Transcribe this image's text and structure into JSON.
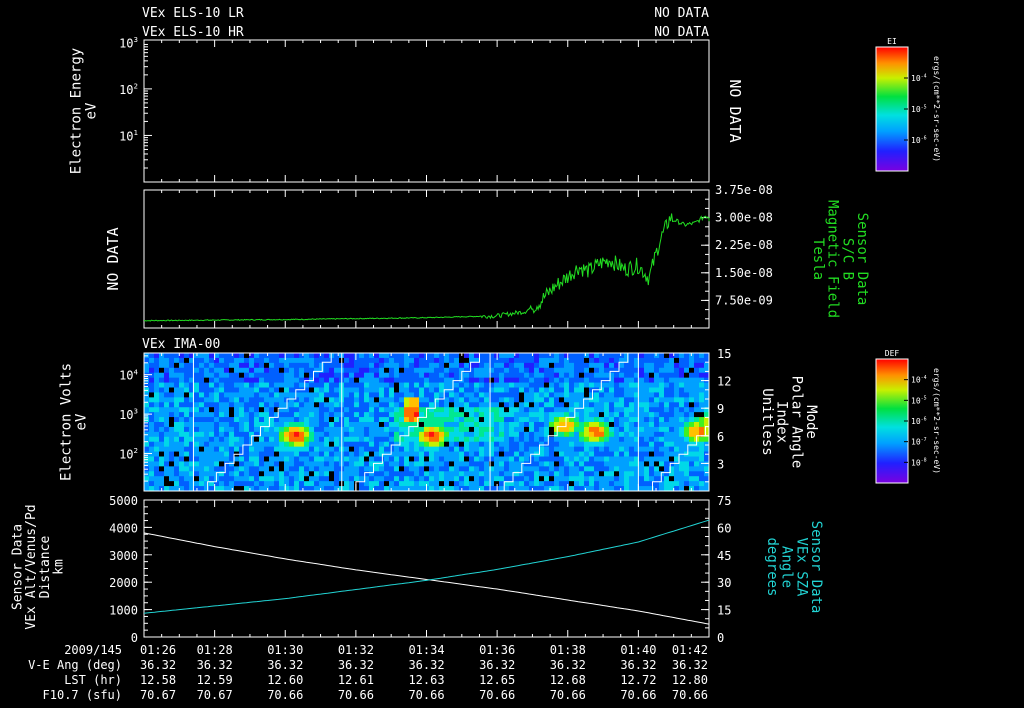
{
  "header": {
    "lr_label": "VEx ELS-10 LR",
    "hr_label": "VEx ELS-10 HR",
    "lr_status": "NO DATA",
    "hr_status": "NO DATA"
  },
  "colors": {
    "background": "#000000",
    "axes": "#ffffff",
    "magnetic_field": "#22dd22",
    "sza": "#22d4d4"
  },
  "chart_data": [
    {
      "type": "heatmap",
      "id": "electron-energy-panel",
      "ylabel": [
        "Electron Energy",
        "eV"
      ],
      "yscale": "log",
      "yticks": [
        {
          "base": "10",
          "exp": "1"
        },
        {
          "base": "10",
          "exp": "2"
        },
        {
          "base": "10",
          "exp": "3"
        }
      ],
      "status": "NO DATA",
      "colorbar": {
        "title": "EI",
        "units": "ergs/(cm**2-sr-sec-eV)",
        "ticks": [
          {
            "base": "10",
            "exp": "-4"
          },
          {
            "base": "10",
            "exp": "-5"
          },
          {
            "base": "10",
            "exp": "-6"
          }
        ]
      }
    },
    {
      "type": "line",
      "id": "magnetic-field-panel",
      "left_status": "NO DATA",
      "ylabel": [
        "Sensor Data",
        "S/C B",
        "Magnetic Field",
        "Tesla"
      ],
      "ylim": [
        0,
        3.75e-08
      ],
      "yticks": [
        "3.75e-08",
        "3.00e-08",
        "2.25e-08",
        "1.50e-08",
        "7.50e-09"
      ],
      "ytick_values": [
        3.75e-08,
        3e-08,
        2.25e-08,
        1.5e-08,
        7.5e-09
      ],
      "x_minutes": [
        0,
        4,
        8,
        10,
        10.8,
        11.2,
        11.6,
        12,
        12.3,
        12.6,
        12.9,
        13.2,
        13.6,
        14,
        14.3,
        14.6,
        14.9,
        15.3,
        15.6,
        15.9,
        16.2,
        16.5
      ],
      "values": [
        2e-09,
        2.3e-09,
        2.8e-09,
        3.3e-09,
        4.5e-09,
        7e-09,
        1.1e-08,
        1.4e-08,
        1.65e-08,
        1.55e-08,
        1.75e-08,
        1.85e-08,
        1.6e-08,
        1.7e-08,
        1.35e-08,
        2.35e-08,
        3e-08,
        2.8e-08,
        2.85e-08,
        3.05e-08,
        2.95e-08,
        2.95e-08
      ]
    },
    {
      "type": "heatmap",
      "id": "ima-panel",
      "title": "VEx IMA-00",
      "ylabel": [
        "Electron Volts",
        "eV"
      ],
      "yscale": "log",
      "yticks": [
        {
          "base": "10",
          "exp": "2"
        },
        {
          "base": "10",
          "exp": "3"
        },
        {
          "base": "10",
          "exp": "4"
        }
      ],
      "right_ylabel": [
        "Mode",
        "Polar Angle",
        "Index",
        "Unitless"
      ],
      "right_ylim": [
        0,
        15
      ],
      "right_yticks": [
        "15",
        "12",
        "9",
        "6",
        "3"
      ],
      "right_ytick_values": [
        15,
        12,
        9,
        6,
        3
      ],
      "sweep_boundaries_minutes": [
        1.4,
        5.6,
        9.8,
        14.0,
        18.1
      ],
      "hotspots": [
        {
          "x_minutes": 4.35,
          "log_energy": 2.45,
          "level": 1.0
        },
        {
          "x_minutes": 8.35,
          "log_energy": 2.45,
          "level": 1.0
        },
        {
          "x_minutes": 12.2,
          "log_energy": 2.7,
          "level": 0.85
        },
        {
          "x_minutes": 13.1,
          "log_energy": 2.55,
          "level": 0.95
        },
        {
          "x_minutes": 16.1,
          "log_energy": 2.55,
          "level": 0.9
        },
        {
          "x_minutes": 16.4,
          "log_energy": 2.8,
          "level": 0.75
        }
      ],
      "colorbar": {
        "title": "DEF",
        "units": "ergs/(cm**2-sr-sec-eV)",
        "ticks": [
          {
            "base": "10",
            "exp": "-4"
          },
          {
            "base": "10",
            "exp": "-5"
          },
          {
            "base": "10",
            "exp": "-6"
          },
          {
            "base": "10",
            "exp": "-7"
          },
          {
            "base": "10",
            "exp": "-8"
          }
        ]
      }
    },
    {
      "type": "line",
      "id": "orbit-panel",
      "ylabel": [
        "Sensor Data",
        "VEx Alt/Venus/Pd",
        "Distance",
        "km"
      ],
      "ylim": [
        0,
        5000
      ],
      "yticks": [
        "5000",
        "4000",
        "3000",
        "2000",
        "1000",
        "0"
      ],
      "ytick_values": [
        5000,
        4000,
        3000,
        2000,
        1000,
        0
      ],
      "right_ylabel": [
        "Sensor Data",
        "VEx SZA",
        "Angle",
        "degrees"
      ],
      "right_ylim": [
        0,
        75
      ],
      "right_yticks": [
        "75",
        "60",
        "45",
        "30",
        "15",
        "0"
      ],
      "right_ytick_values": [
        75,
        60,
        45,
        30,
        15,
        0
      ],
      "series": [
        {
          "name": "VEx Alt/Venus/Pd Distance",
          "axis": "left",
          "x_minutes": [
            0,
            2,
            4,
            6,
            8,
            10,
            12,
            14,
            16
          ],
          "values": [
            3800,
            3300,
            2850,
            2450,
            2100,
            1750,
            1350,
            950,
            470
          ]
        },
        {
          "name": "VEx SZA Angle",
          "axis": "right",
          "x_minutes": [
            0,
            2,
            4,
            6,
            8,
            10,
            12,
            14,
            16
          ],
          "values": [
            13,
            17,
            21,
            26,
            31,
            37,
            44,
            52,
            64
          ]
        }
      ]
    }
  ],
  "time_axis": {
    "range_minutes": [
      0,
      16
    ],
    "rows": [
      {
        "label": "2009/145",
        "values": [
          "01:26",
          "01:28",
          "01:30",
          "01:32",
          "01:34",
          "01:36",
          "01:38",
          "01:40",
          "01:42"
        ]
      },
      {
        "label": "V-E Ang (deg)",
        "values": [
          "36.32",
          "36.32",
          "36.32",
          "36.32",
          "36.32",
          "36.32",
          "36.32",
          "36.32",
          "36.32"
        ]
      },
      {
        "label": "LST (hr)",
        "values": [
          "12.58",
          "12.59",
          "12.60",
          "12.61",
          "12.63",
          "12.65",
          "12.68",
          "12.72",
          "12.80"
        ]
      },
      {
        "label": "F10.7 (sfu)",
        "values": [
          "70.67",
          "70.67",
          "70.66",
          "70.66",
          "70.66",
          "70.66",
          "70.66",
          "70.66",
          "70.66"
        ]
      }
    ]
  }
}
